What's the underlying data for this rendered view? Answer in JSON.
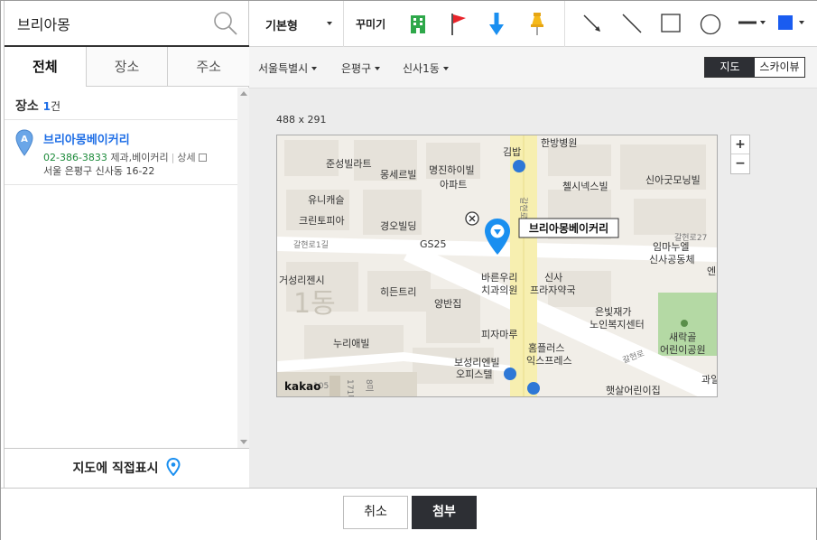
{
  "search": {
    "value": "브리아몽",
    "placeholder": ""
  },
  "tabs": [
    {
      "label": "전체"
    },
    {
      "label": "장소"
    },
    {
      "label": "주소"
    }
  ],
  "places": {
    "label": "장소",
    "count": "1",
    "unit": "건"
  },
  "results": [
    {
      "marker": "A",
      "name": "브리아몽베이커리",
      "phone": "02-386-3833",
      "category": "제과,베이커리",
      "detail": "상세",
      "address": "서울 은평구 신사동 16-22"
    }
  ],
  "direct_mark": {
    "label": "지도에 직접표시"
  },
  "toolbar": {
    "style_label": "기본형",
    "decorate_label": "꾸미기",
    "icons": [
      "building-marker-icon",
      "flag-marker-icon",
      "arrow-down-marker-icon",
      "pushpin-marker-icon",
      "arrow-line-icon",
      "line-icon",
      "rectangle-icon",
      "circle-icon",
      "line-style-icon",
      "color-picker-icon"
    ],
    "accent_color": "#1a5cf0"
  },
  "breadcrumb": {
    "city": "서울특별시",
    "district": "은평구",
    "dong": "신사1동"
  },
  "map_type": {
    "map": "지도",
    "skyview": "스카이뷰"
  },
  "map": {
    "size_label": "488 x 291",
    "place_label": "브리아몽베이커리",
    "marker_color": "#1a8ff0",
    "logo": "kakao",
    "labels": {
      "hospital": "한방병원",
      "gimbap": "김밥",
      "junseong": "준성빌라트",
      "mongserel": "몽세르빌",
      "myeongjin": "명진하이빌\n아파트",
      "chelseanex": "첼시넥스빌",
      "sinagut": "신아굿모닝빌",
      "yunicastle": "유니캐슬",
      "crown": "크린토피아",
      "gyeongo": "경오빌딩",
      "gs25": "GS25",
      "road1": "갈현로1길",
      "imma": "임마누엘\n신사공동체",
      "geoseong": "거성리젠시",
      "dong": "1동",
      "hidden": "히든트리",
      "yangban": "양반집",
      "bareun": "바른우리\n치과의원",
      "sinsa_pharm": "신사\n프라자약국",
      "eunbit": "은빛재가\n노인복지센터",
      "park": "새락골\n어린이공원",
      "nuri": "누리애빌",
      "pizza": "피자마루",
      "homeplus": "홈플러스\n익스프레스",
      "boseong": "보성리엔빌\n오피스텔",
      "haessal": "햇살어린이집",
      "road_main": "갈현로",
      "road2": "갈현로",
      "road27": "갈현로27",
      "gwail": "과일",
      "en": "엔",
      "num105": "105",
      "num171": "171미",
      "num8": "8미"
    }
  },
  "zoom": {
    "in": "+",
    "out": "−"
  },
  "footer": {
    "cancel": "취소",
    "attach": "첨부"
  }
}
